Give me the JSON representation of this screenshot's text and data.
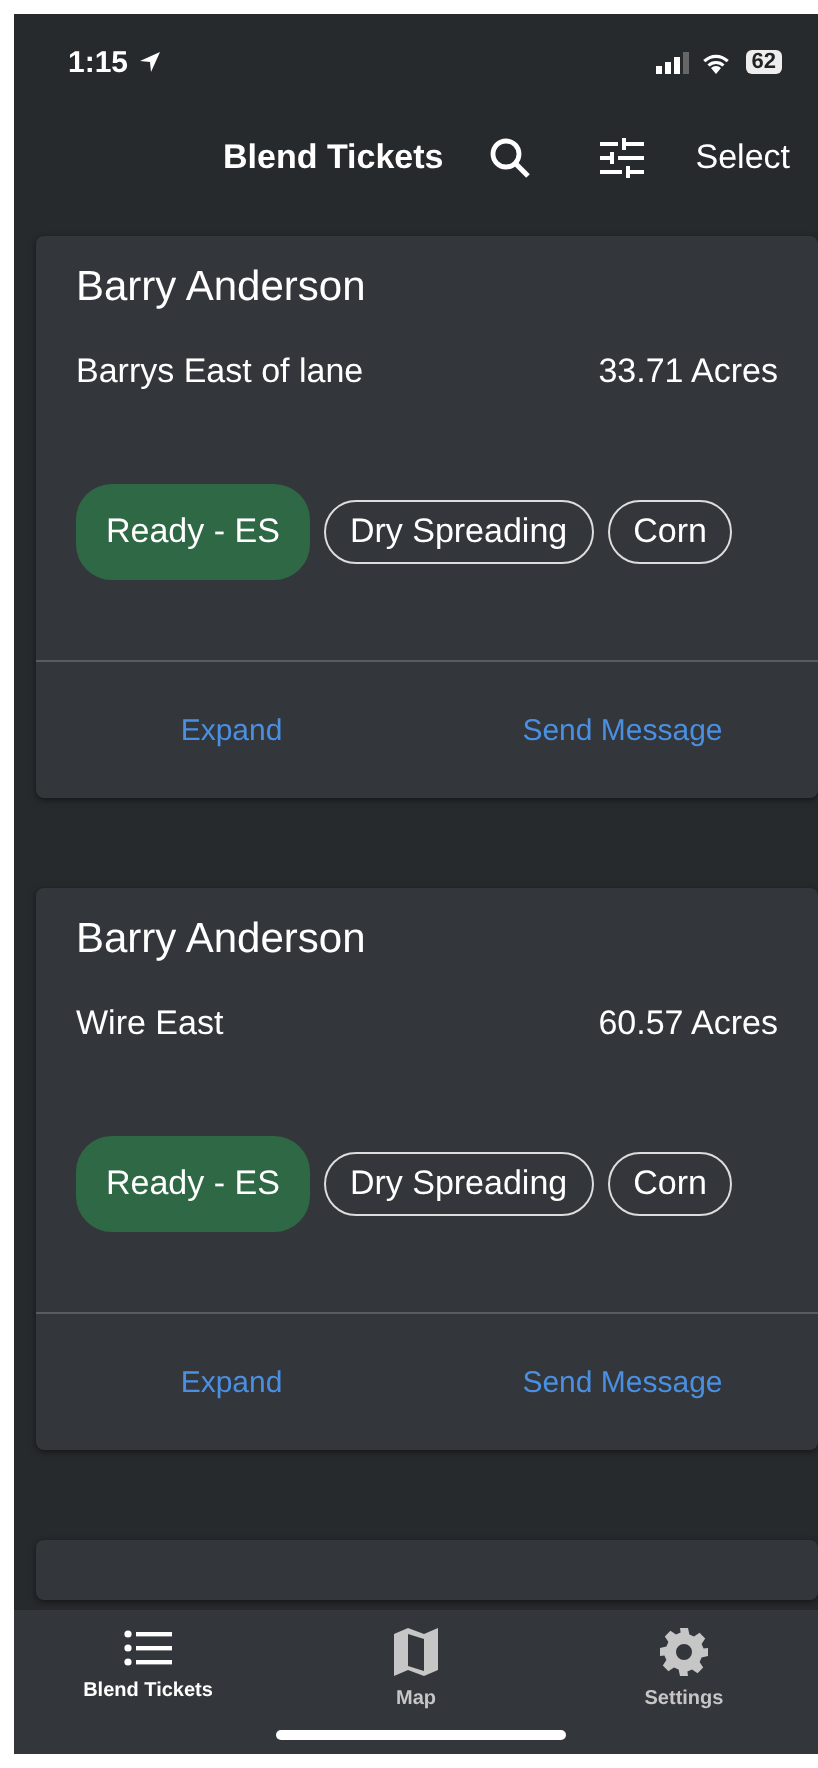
{
  "status_bar": {
    "time": "1:15",
    "battery": "62"
  },
  "nav_bar": {
    "title": "Blend Tickets",
    "action": "Select"
  },
  "tickets": [
    {
      "customer": "Barry Anderson",
      "field": "Barrys East of lane",
      "area": "33.71 Acres",
      "tags": [
        {
          "label": "Ready - ES",
          "kind": "status",
          "color": "#2f6845"
        },
        {
          "label": "Dry Spreading",
          "kind": "outline"
        },
        {
          "label": "Corn",
          "kind": "outline"
        }
      ],
      "actions": [
        "Expand",
        "Send Message"
      ]
    },
    {
      "customer": "Barry Anderson",
      "field": "Wire East",
      "area": "60.57 Acres",
      "tags": [
        {
          "label": "Ready - ES",
          "kind": "status",
          "color": "#2f6845"
        },
        {
          "label": "Dry Spreading",
          "kind": "outline"
        },
        {
          "label": "Corn",
          "kind": "outline"
        }
      ],
      "actions": [
        "Expand",
        "Send Message"
      ]
    }
  ],
  "tab_bar": [
    {
      "label": "Blend Tickets",
      "kind": "list",
      "selected": true
    },
    {
      "label": "Map",
      "kind": "map",
      "selected": false
    },
    {
      "label": "Settings",
      "kind": "gear",
      "selected": false
    }
  ]
}
